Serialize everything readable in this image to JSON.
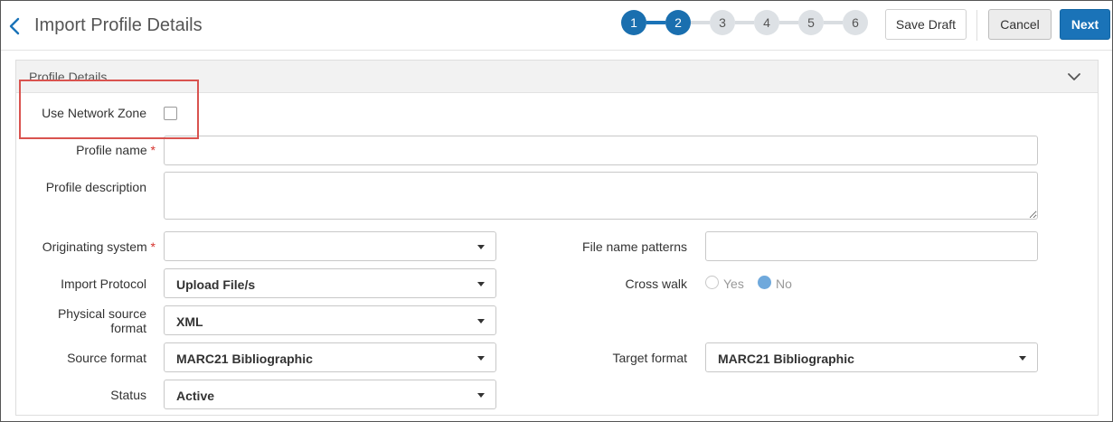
{
  "header": {
    "title": "Import Profile Details",
    "steps": [
      "1",
      "2",
      "3",
      "4",
      "5",
      "6"
    ],
    "active_step": 2,
    "save_draft_label": "Save Draft",
    "cancel_label": "Cancel",
    "next_label": "Next"
  },
  "section": {
    "title": "Profile Details"
  },
  "fields": {
    "use_network_zone": {
      "label": "Use Network Zone",
      "checked": false
    },
    "profile_name": {
      "label": "Profile name",
      "required_mark": "*",
      "value": ""
    },
    "profile_description": {
      "label": "Profile description",
      "value": ""
    },
    "originating_system": {
      "label": "Originating system",
      "required_mark": "*",
      "value": ""
    },
    "file_name_patterns": {
      "label": "File name patterns",
      "value": ""
    },
    "import_protocol": {
      "label": "Import Protocol",
      "value": "Upload File/s"
    },
    "cross_walk": {
      "label": "Cross walk",
      "options": [
        "Yes",
        "No"
      ],
      "selected": "No"
    },
    "physical_source_format": {
      "label_line1": "Physical source",
      "label_line2": "format",
      "value": "XML"
    },
    "source_format": {
      "label": "Source format",
      "value": "MARC21 Bibliographic"
    },
    "target_format": {
      "label": "Target format",
      "value": "MARC21 Bibliographic"
    },
    "status": {
      "label": "Status",
      "value": "Active"
    }
  },
  "colors": {
    "accent": "#1a73b8",
    "highlight_box": "#d9534f",
    "required": "#d6322c",
    "radio_selected": "#6fa9dc"
  }
}
